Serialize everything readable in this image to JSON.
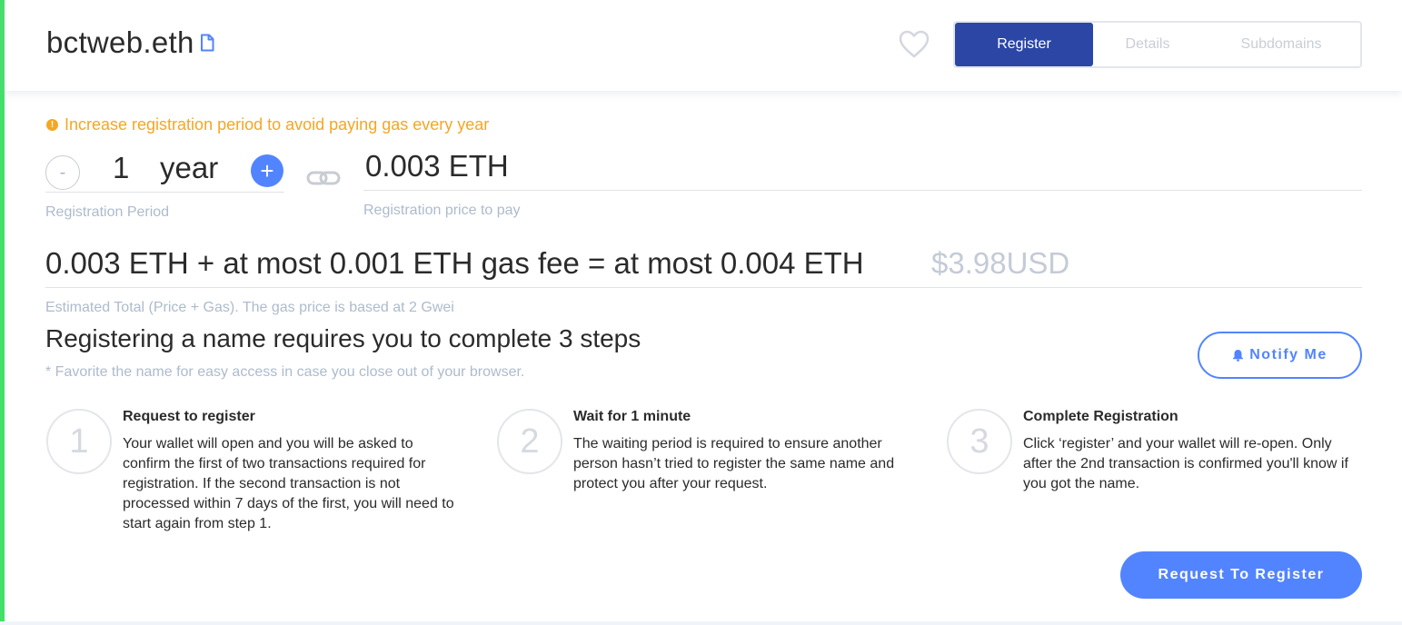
{
  "domain": {
    "name": "bctweb.eth"
  },
  "tabs": [
    {
      "label": "Register",
      "active": true
    },
    {
      "label": "Details",
      "active": false
    },
    {
      "label": "Subdomains",
      "active": false
    }
  ],
  "warning": {
    "text": "Increase registration period to avoid paying gas every year",
    "icon": "!"
  },
  "period": {
    "minus_label": "-",
    "value": "1",
    "unit": "year",
    "plus_label": "+",
    "label": "Registration Period"
  },
  "price": {
    "value": "0.003 ETH",
    "label": "Registration price to pay"
  },
  "total": {
    "value": "0.003 ETH + at most 0.001 ETH gas fee = at most 0.004 ETH",
    "usd": "$3.98USD",
    "label": "Estimated Total (Price + Gas). The gas price is based at 2 Gwei"
  },
  "steps_section": {
    "title": "Registering a name requires you to complete 3 steps",
    "subtitle": "* Favorite the name for easy access in case you close out of your browser.",
    "notify_label": "Notify Me"
  },
  "steps": [
    {
      "number": "1",
      "title": "Request to register",
      "description": "Your wallet will open and you will be asked to confirm the first of two transactions required for registration. If the second transaction is not processed within 7 days of the first, you will need to start again from step 1."
    },
    {
      "number": "2",
      "title": "Wait for 1 minute",
      "description": "The waiting period is required to ensure another person hasn’t tried to register the same name and protect you after your request."
    },
    {
      "number": "3",
      "title": "Complete Registration",
      "description": "Click ‘register’ and your wallet will re-open. Only after the 2nd transaction is confirmed you'll know if you got the name."
    }
  ],
  "actions": {
    "request_label": "Request To Register"
  },
  "colors": {
    "accent": "#5284ff",
    "tab_active": "#2c46a6",
    "warning": "#f5a623",
    "left_accent": "#42e068",
    "muted_label": "#adbbcd"
  }
}
